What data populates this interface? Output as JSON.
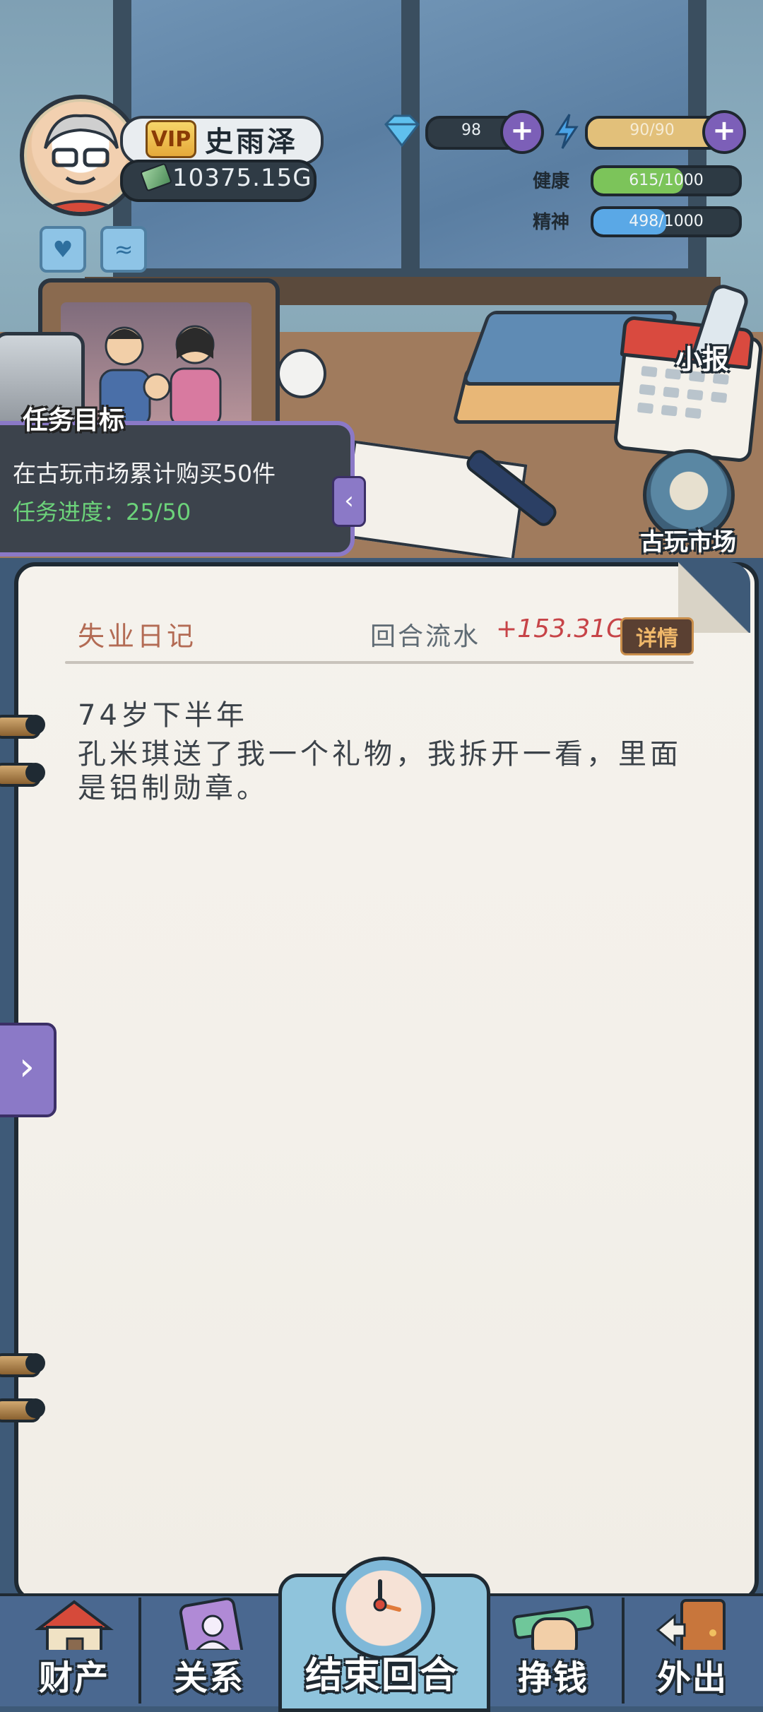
{
  "player": {
    "vip_label": "VIP",
    "name": "史雨泽",
    "money": "10375.15G"
  },
  "resources": {
    "diamonds": "98",
    "energy": "90/90",
    "health_label": "健康",
    "health": "615/1000",
    "health_fraction": 0.615,
    "spirit_label": "精神",
    "spirit": "498/1000",
    "spirit_fraction": 0.498
  },
  "quest": {
    "title": "任务目标",
    "description": "在古玩市场累计购买50件",
    "progress": "任务进度：25/50"
  },
  "shortcuts": {
    "news": "小报",
    "market": "古玩市场"
  },
  "diary": {
    "title": "失业日记",
    "flow_label": "回合流水",
    "flow_value": "+153.31G",
    "detail_button": "详情",
    "entry_age": "74岁下半年",
    "entry_text": "孔米琪送了我一个礼物，我拆开一看，里面是铝制勋章。"
  },
  "nav": {
    "assets": "财产",
    "relations": "关系",
    "end_turn": "结束回合",
    "earn": "挣钱",
    "go_out": "外出"
  },
  "colors": {
    "health_bar": "#7cc45a",
    "spirit_bar": "#5aa8e6",
    "energy_bar": "#e2c07a",
    "accent_purple": "#8b79c7",
    "flow_positive": "#c74448"
  }
}
